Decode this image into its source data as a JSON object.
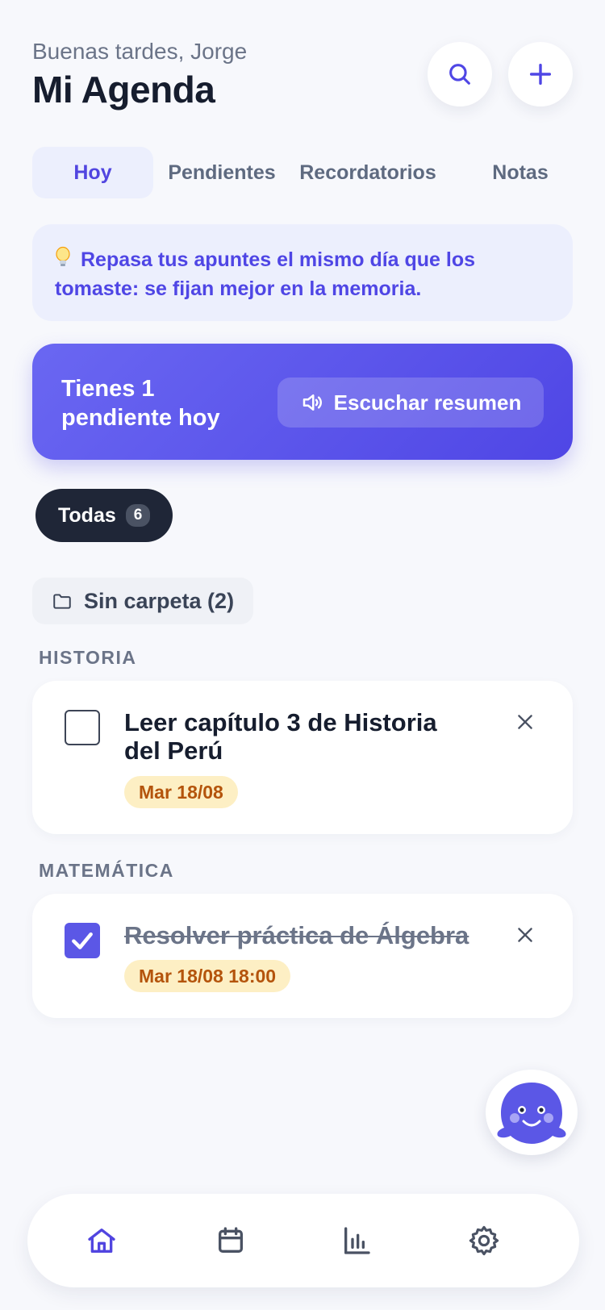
{
  "header": {
    "greeting": "Buenas tardes, Jorge",
    "title": "Mi Agenda"
  },
  "actions": {
    "search_icon": "search-icon",
    "add_icon": "plus-icon"
  },
  "tabs": [
    {
      "label": "Hoy",
      "active": true
    },
    {
      "label": "Pendientes",
      "active": false
    },
    {
      "label": "Recordatorios",
      "active": false
    },
    {
      "label": "Notas",
      "active": false
    }
  ],
  "tip": {
    "icon": "lightbulb-icon",
    "text": "Repasa tus apuntes el mismo día que los tomaste: se fijan mejor en la memoria."
  },
  "banner": {
    "text": "Tienes 1 pendiente hoy",
    "listen_label": "Escuchar resumen",
    "listen_icon": "speaker-icon"
  },
  "filter": {
    "label": "Todas",
    "count": "6"
  },
  "folder": {
    "label": "Sin carpeta (2)",
    "icon": "folder-icon"
  },
  "groups": [
    {
      "label": "HISTORIA",
      "tasks": [
        {
          "title": "Leer capítulo 3 de Historia del Perú",
          "date": "Mar 18/08",
          "done": false
        }
      ]
    },
    {
      "label": "MATEMÁTICA",
      "tasks": [
        {
          "title": "Resolver práctica de Álgebra",
          "date": "Mar 18/08 18:00",
          "done": true
        }
      ]
    }
  ],
  "assistant": {
    "icon": "mascot-icon"
  },
  "nav": [
    {
      "icon": "home-icon",
      "active": true
    },
    {
      "icon": "calendar-icon",
      "active": false
    },
    {
      "icon": "stats-icon",
      "active": false
    },
    {
      "icon": "settings-icon",
      "active": false
    }
  ],
  "colors": {
    "accent": "#4f46e5",
    "background": "#f7f8fc",
    "date_badge_bg": "#fdefc4",
    "date_badge_text": "#b4540c"
  }
}
